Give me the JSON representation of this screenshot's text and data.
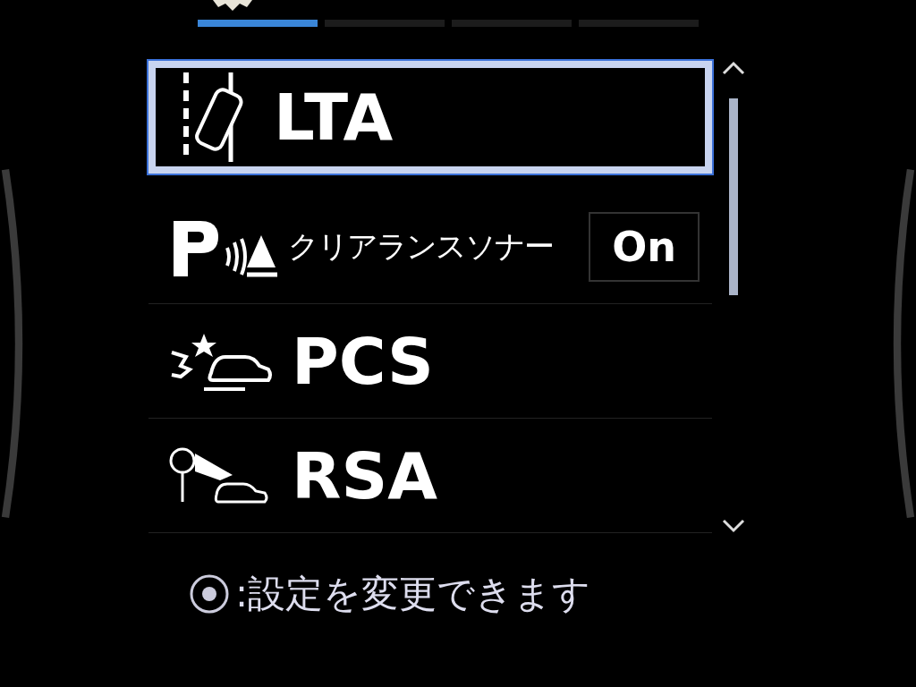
{
  "tab_indicators": [
    {
      "selected": true
    },
    {
      "selected": false
    },
    {
      "selected": false
    },
    {
      "selected": false
    }
  ],
  "items": [
    {
      "kind": "lta",
      "label": "LTA",
      "selected": true
    },
    {
      "kind": "sonar",
      "label": "クリアランスソナー",
      "value": "On",
      "selected": false
    },
    {
      "kind": "pcs",
      "label": "PCS",
      "selected": false
    },
    {
      "kind": "rsa",
      "label": "RSA",
      "selected": false
    }
  ],
  "hint": {
    "text": ":設定を変更できます"
  }
}
